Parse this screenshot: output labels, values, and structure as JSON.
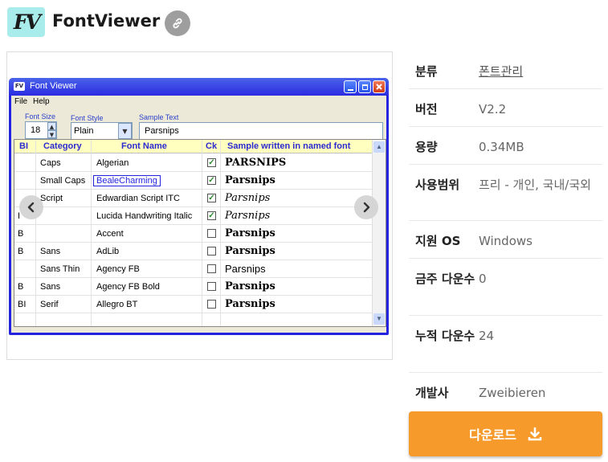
{
  "app": {
    "logo_text": "FV",
    "title": "FontViewer"
  },
  "screenshot": {
    "window_title": "Font Viewer",
    "menu": [
      "File",
      "Help"
    ],
    "font_size_label": "Font Size",
    "font_size_value": "18",
    "font_style_label": "Font Style",
    "font_style_value": "Plain",
    "sample_text_label": "Sample Text",
    "sample_text_value": "Parsnips",
    "columns": [
      "BI",
      "Category",
      "Font Name",
      "Ck",
      "Sample written in named font"
    ],
    "rows": [
      {
        "bi": "",
        "category": "Caps",
        "font": "Algerian",
        "checked": true,
        "sample": "PARSNIPS"
      },
      {
        "bi": "",
        "category": "Small Caps",
        "font": "BealeCharming",
        "checked": true,
        "sample": "Parsnips"
      },
      {
        "bi": "",
        "category": "Script",
        "font": "Edwardian Script ITC",
        "checked": true,
        "sample": "Parsnips"
      },
      {
        "bi": "I",
        "category": "",
        "font": "Lucida Handwriting Italic",
        "checked": true,
        "sample": "Parsnips"
      },
      {
        "bi": "B",
        "category": "",
        "font": "Accent",
        "checked": false,
        "sample": "Parsnips"
      },
      {
        "bi": "B",
        "category": "Sans",
        "font": "AdLib",
        "checked": false,
        "sample": "Parsnips"
      },
      {
        "bi": "",
        "category": "Sans Thin",
        "font": "Agency FB",
        "checked": false,
        "sample": "Parsnips"
      },
      {
        "bi": "B",
        "category": "Sans",
        "font": "Agency FB Bold",
        "checked": false,
        "sample": "Parsnips"
      },
      {
        "bi": "BI",
        "category": "Serif",
        "font": "Allegro BT",
        "checked": false,
        "sample": "Parsnips"
      }
    ]
  },
  "info": {
    "rows": [
      {
        "label": "분류",
        "value": "폰트관리",
        "link": true
      },
      {
        "label": "버전",
        "value": "V2.2"
      },
      {
        "label": "용량",
        "value": "0.34MB"
      },
      {
        "label": "사용범위",
        "value": "프리 - 개인, 국내/국외"
      },
      {
        "label": "지원 OS",
        "value": "Windows"
      },
      {
        "label": "금주 다운수",
        "value": "0"
      },
      {
        "label": "누적 다운수",
        "value": "24"
      },
      {
        "label": "개발사",
        "value": "Zweibieren"
      }
    ]
  },
  "download": {
    "label": "다운로드"
  },
  "colors": {
    "accent": "#f59a2b",
    "logo_bg": "#a8ecec",
    "link_icon_bg": "#9e9e9e"
  },
  "icons": [
    "link-icon",
    "chevron-left-icon",
    "chevron-right-icon",
    "download-icon"
  ]
}
